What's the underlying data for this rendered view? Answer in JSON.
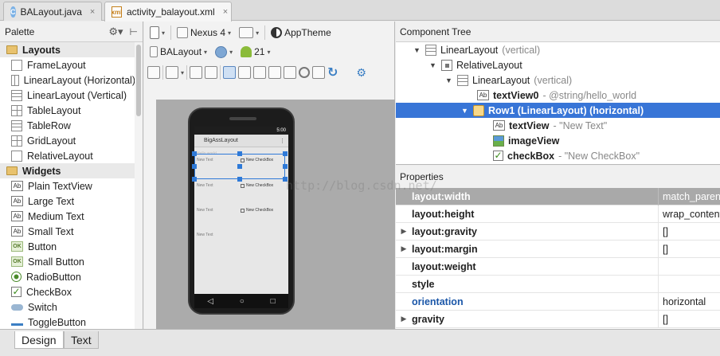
{
  "tabs": [
    {
      "label": "BALayout.java",
      "icon": "java-class-icon",
      "badge": "C"
    },
    {
      "label": "activity_balayout.xml",
      "icon": "xml-file-icon",
      "badge": "xml"
    }
  ],
  "tab_close_glyph": "×",
  "palette": {
    "title": "Palette",
    "groups": [
      {
        "label": "Layouts",
        "items": [
          "FrameLayout",
          "LinearLayout (Horizontal)",
          "LinearLayout (Vertical)",
          "TableLayout",
          "TableRow",
          "GridLayout",
          "RelativeLayout"
        ]
      },
      {
        "label": "Widgets",
        "items": [
          "Plain TextView",
          "Large Text",
          "Medium Text",
          "Small Text",
          "Button",
          "Small Button",
          "RadioButton",
          "CheckBox",
          "Switch",
          "ToggleButton"
        ]
      }
    ]
  },
  "toolbar": {
    "device": "Nexus 4",
    "theme": "AppTheme",
    "layout_name": "BALayout",
    "api_level": "21"
  },
  "preview": {
    "status_time": "5:00",
    "app_title": "BigAssLayout",
    "hello": "Hello world",
    "rows": [
      {
        "text": "New Text",
        "checkbox": "New CheckBox"
      },
      {
        "text": "New Text",
        "checkbox": "New CheckBox"
      },
      {
        "text": "New Text",
        "checkbox": "New CheckBox"
      },
      {
        "text": "New Text"
      }
    ],
    "nav_back": "◁",
    "nav_home": "○",
    "nav_recent": "□"
  },
  "component_tree": {
    "title": "Component Tree",
    "nodes": [
      {
        "name": "LinearLayout",
        "detail": "(vertical)"
      },
      {
        "name": "RelativeLayout",
        "detail": ""
      },
      {
        "name": "LinearLayout",
        "detail": "(vertical)"
      },
      {
        "name": "textView0",
        "detail": "- @string/hello_world"
      },
      {
        "name": "Row1 (LinearLayout) (horizontal)",
        "detail": ""
      },
      {
        "name": "textView",
        "detail": "- \"New Text\""
      },
      {
        "name": "imageView",
        "detail": ""
      },
      {
        "name": "checkBox",
        "detail": "- \"New CheckBox\""
      }
    ]
  },
  "properties": {
    "title": "Properties",
    "rows": [
      {
        "name": "layout:width",
        "value": "match_parent"
      },
      {
        "name": "layout:height",
        "value": "wrap_content"
      },
      {
        "name": "layout:gravity",
        "value": "[]"
      },
      {
        "name": "layout:margin",
        "value": "[]"
      },
      {
        "name": "layout:weight",
        "value": ""
      },
      {
        "name": "style",
        "value": ""
      },
      {
        "name": "orientation",
        "value": "horizontal"
      },
      {
        "name": "gravity",
        "value": "[]"
      }
    ]
  },
  "bottom_tabs": [
    "Design",
    "Text"
  ],
  "watermark": "http://blog.csdn.net/"
}
